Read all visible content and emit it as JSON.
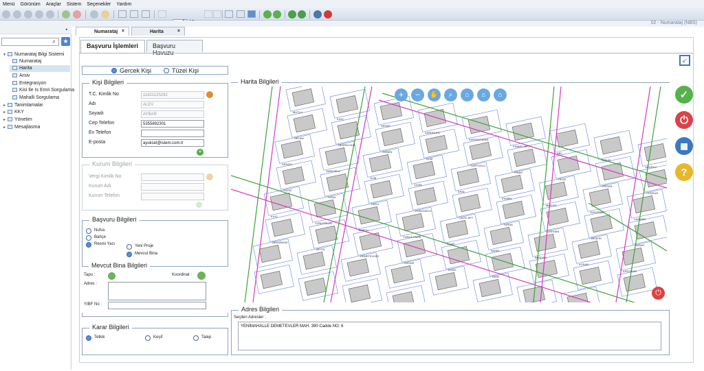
{
  "menu": [
    "Menü",
    "Görünüm",
    "Araçlar",
    "Sistem",
    "Seçenekler",
    "Yardım"
  ],
  "toolbar": {
    "page_value": "0",
    "page_total": "/ 0"
  },
  "app_title": "02 - Numarataj (NBS)",
  "tree": [
    {
      "label": "Numarataj Bilgi Sistemi",
      "level": 0,
      "expanded": true
    },
    {
      "label": "Numarataj",
      "level": 1
    },
    {
      "label": "Harita",
      "level": 1,
      "selected": true
    },
    {
      "label": "Arsiv",
      "level": 1
    },
    {
      "label": "Entegrasyon",
      "level": 1
    },
    {
      "label": "Kisi Ile Is Emri Sorgulama",
      "level": 1
    },
    {
      "label": "Mahalli Sorgulama",
      "level": 1
    },
    {
      "label": "Tanimlamalar",
      "level": 0
    },
    {
      "label": "KKY",
      "level": 0
    },
    {
      "label": "Yönetim",
      "level": 0
    },
    {
      "label": "Mesajlasma",
      "level": 0
    }
  ],
  "doc_tabs": [
    {
      "label": "Numarataj"
    },
    {
      "label": "Harita"
    }
  ],
  "sub_tabs": [
    "Başvuru İşlemleri",
    "Başvuru Havuzu"
  ],
  "person_type": {
    "options": [
      "Gercek Kişi",
      "Tüzel Kişi"
    ],
    "selected": "Gercek Kişi"
  },
  "kisi": {
    "legend": "Kişi Bilgileri",
    "fields": [
      {
        "label": "T.C. Kimlik No",
        "value": "11621125292",
        "readonly": true
      },
      {
        "label": "Adı",
        "value": "ALEV",
        "readonly": true
      },
      {
        "label": "Soyadı",
        "value": "AYBAR",
        "readonly": true
      },
      {
        "label": "Cep Telefon",
        "value": "5355892301",
        "readonly": false
      },
      {
        "label": "Ev Telefon",
        "value": "",
        "readonly": false
      },
      {
        "label": "E-posta",
        "value": "ayuksel@islem.com.tr",
        "readonly": false
      }
    ]
  },
  "kurum": {
    "legend": "Kurum Bilgileri",
    "fields": [
      {
        "label": "Vergi Kimlik No"
      },
      {
        "label": "Kurum Adı"
      },
      {
        "label": "Kurum Telefon"
      }
    ]
  },
  "basvuru": {
    "legend": "Başvuru Bilgileri",
    "options": [
      "Nufus",
      "Bahçe",
      "Resmi Yazı"
    ],
    "selected": "Resmi Yazı",
    "sub_options": [
      "Yeni Proje",
      "Mevcut Bina"
    ],
    "sub_selected": "Mevcut Bina"
  },
  "mevcut": {
    "legend": "Mevcut Bina Bilgileri",
    "tapu": "Tapu :",
    "koordinat": "Koordinat :",
    "adres": "Adres :",
    "yibf": "YIBF No :"
  },
  "karar": {
    "legend": "Karar Bilgileri",
    "options": [
      "Tetkik",
      "Keşif",
      "Talep"
    ],
    "selected": "Tetkik"
  },
  "harita": {
    "legend": "Harita Bilgileri"
  },
  "adres": {
    "legend": "Adres Bilgileri",
    "secilen_label": "Seçilen Adresler :",
    "text": "YENİMAHALLE DEMETEVLER MAH. 390 Cadde NO: 6"
  },
  "map_labels": [
    "MUTLU",
    "KILIÇ",
    "SERAP",
    "KARDELEN",
    "KARSIAYURAN",
    "PINARLI APT.",
    "ABC",
    "HUZUR",
    "UGURLU",
    "SELAM",
    "NESRIN NUR",
    "ÖZMEN",
    "ALIM",
    "YURTOGLU",
    "PINAR",
    "FEVZI",
    "ERGÜN",
    "COŞKUN",
    "DENİZLİ",
    "SARIOĞLU",
    "ALİM",
    "ÇİÇEK",
    "ERİN",
    "EKMEN",
    "MERTEL",
    "ÖZDOĞAN",
    "CANDAN",
    "YILDIZ",
    "TURAL",
    "FADLI",
    "KÖRGÜRCÜ",
    "ÇİLEK APT",
    "TURNA",
    "GÖKHAN",
    "BEŞKIN",
    "SUNAY",
    "KILIÇ",
    "TURKOĞLAN",
    "BURCU",
    "YUNUS EMRE",
    "ACAR",
    "ŞAHİN",
    "BERDAN",
    "KODAN",
    "ERDOĞAN",
    "DENİZBEDE",
    "AKYOL",
    "DEMETEVLER",
    "ÖZGÜR",
    "KÖSE",
    "EKİM"
  ]
}
